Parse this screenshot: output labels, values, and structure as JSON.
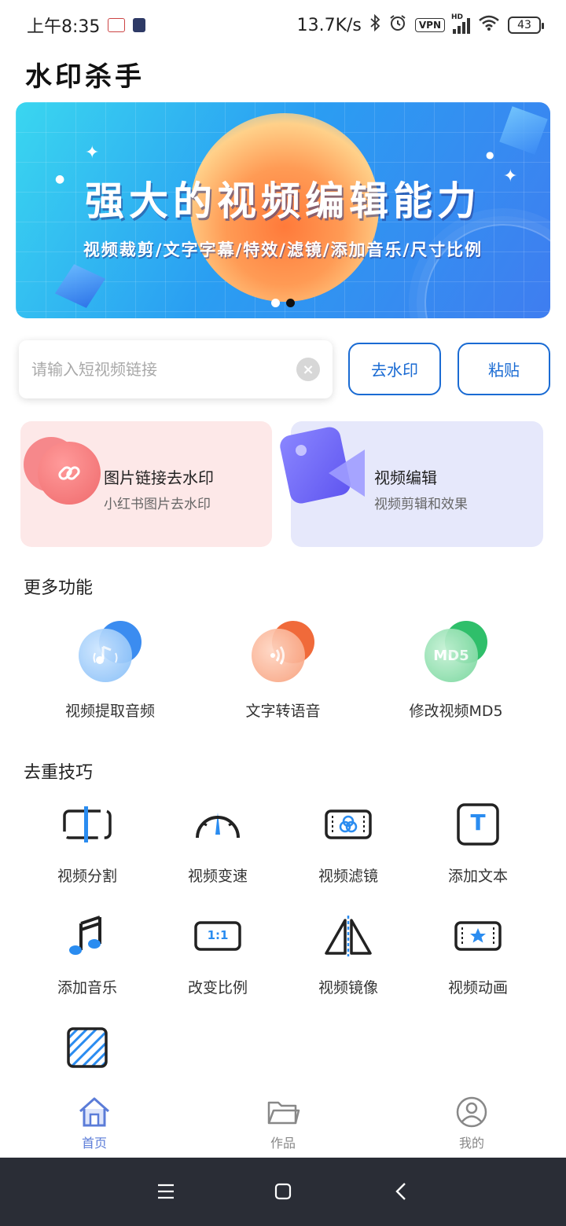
{
  "status_bar": {
    "time": "上午8:35",
    "net_speed": "13.7K/s",
    "vpn": "VPN",
    "hd": "HD",
    "battery": "43"
  },
  "app": {
    "title": "水印杀手"
  },
  "banner": {
    "title": "强大的视频编辑能力",
    "subtitle": "视频裁剪/文字字幕/特效/滤镜/添加音乐/尺寸比例",
    "slide_count": 2,
    "active_slide": 2
  },
  "url_input": {
    "placeholder": "请输入短视频链接",
    "value": ""
  },
  "buttons": {
    "remove_watermark": "去水印",
    "paste": "粘贴"
  },
  "cards": [
    {
      "title": "图片链接去水印",
      "subtitle": "小红书图片去水印",
      "icon": "link-icon"
    },
    {
      "title": "视频编辑",
      "subtitle": "视频剪辑和效果",
      "icon": "video-edit-icon"
    }
  ],
  "more_features": {
    "title": "更多功能",
    "items": [
      {
        "label": "视频提取音频",
        "icon": "music-note-icon",
        "color": "#3b8cf0"
      },
      {
        "label": "文字转语音",
        "icon": "sound-wave-icon",
        "color": "#f06a3a"
      },
      {
        "label": "修改视频MD5",
        "icon": "md5-icon",
        "badge": "MD5",
        "color": "#2fbf6a"
      }
    ]
  },
  "dedup_tips": {
    "title": "去重技巧",
    "items": [
      {
        "label": "视频分割",
        "icon": "split-icon"
      },
      {
        "label": "视频变速",
        "icon": "speedometer-icon"
      },
      {
        "label": "视频滤镜",
        "icon": "filter-icon"
      },
      {
        "label": "添加文本",
        "icon": "text-icon",
        "badge": "T"
      },
      {
        "label": "添加音乐",
        "icon": "music-icon"
      },
      {
        "label": "改变比例",
        "icon": "ratio-icon",
        "badge": "1:1"
      },
      {
        "label": "视频镜像",
        "icon": "mirror-icon"
      },
      {
        "label": "视频动画",
        "icon": "animation-icon"
      },
      {
        "label": "",
        "icon": "hatch-icon"
      }
    ]
  },
  "bottom_nav": {
    "items": [
      {
        "label": "首页",
        "icon": "home-icon",
        "active": true
      },
      {
        "label": "作品",
        "icon": "folder-icon",
        "active": false
      },
      {
        "label": "我的",
        "icon": "profile-icon",
        "active": false
      }
    ]
  },
  "colors": {
    "accent": "#1a6bd3",
    "nav_active": "#5b7cd8",
    "system_nav": "#2a2d36"
  }
}
